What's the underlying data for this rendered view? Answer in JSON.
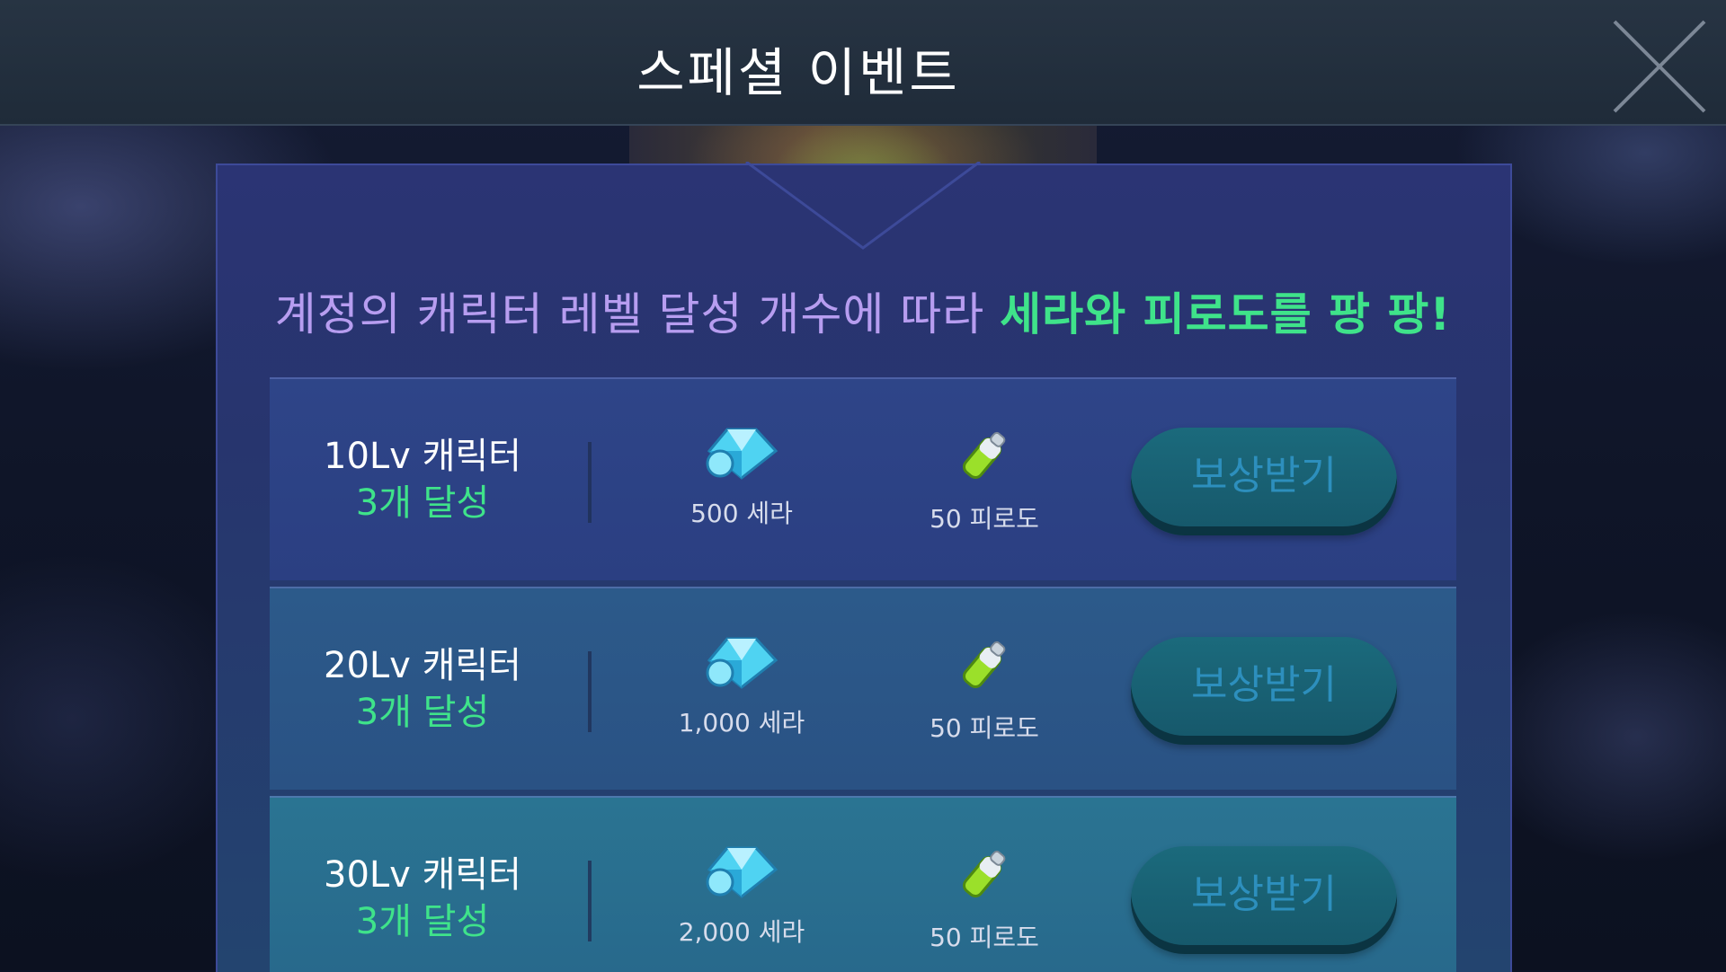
{
  "header": {
    "title": "스페셜 이벤트",
    "close_icon": "close-icon"
  },
  "event": {
    "headline_prefix": "계정의 캐릭터 레벨 달성 개수에 따라",
    "headline_highlight": "세라와 피로도를 팡 팡!"
  },
  "rewards": [
    {
      "level": "10Lv 캐릭터",
      "count": "3개 달성",
      "cera": "500 세라",
      "fatigue": "50 피로도",
      "button": "보상받기"
    },
    {
      "level": "20Lv 캐릭터",
      "count": "3개 달성",
      "cera": "1,000 세라",
      "fatigue": "50 피로도",
      "button": "보상받기"
    },
    {
      "level": "30Lv 캐릭터",
      "count": "3개 달성",
      "cera": "2,000 세라",
      "fatigue": "50 피로도",
      "button": "보상받기"
    }
  ],
  "icons": {
    "cera": "cera-crystal-icon",
    "fatigue": "fatigue-potion-icon"
  },
  "colors": {
    "highlight_green": "#3fe38a",
    "headline_purple": "#b79df0",
    "button_text": "#2d8fbd"
  }
}
